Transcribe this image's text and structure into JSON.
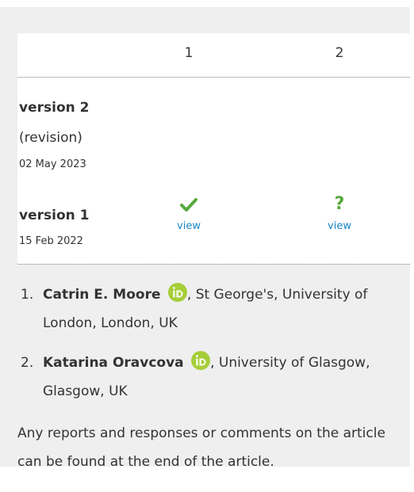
{
  "table": {
    "columns": [
      "1",
      "2"
    ],
    "versions": [
      {
        "title": "version 2",
        "subtitle": "(revision)",
        "date": "02 May 2023"
      },
      {
        "title": "version 1",
        "date": "15 Feb 2022",
        "reports": [
          {
            "status_icon": "check-icon",
            "link_label": "view"
          },
          {
            "status_icon": "question-icon",
            "link_label": "view",
            "glyph": "?"
          }
        ]
      }
    ]
  },
  "authors": [
    {
      "number": "1.",
      "name": "Catrin E. Moore",
      "orcid_icon": "orcid-icon",
      "affiliation": ", St George's, University of London, London, UK"
    },
    {
      "number": "2.",
      "name": "Katarina Oravcova",
      "orcid_icon": "orcid-icon",
      "affiliation": ", University of Glasgow, Glasgow, UK"
    }
  ],
  "footer_note": "Any reports and responses or comments on the article can be found at the end of the article.",
  "colors": {
    "panel_bg": "#efefef",
    "status_green": "#58a83e",
    "link_blue": "#1a86c6",
    "orcid_green": "#a6ce39"
  }
}
